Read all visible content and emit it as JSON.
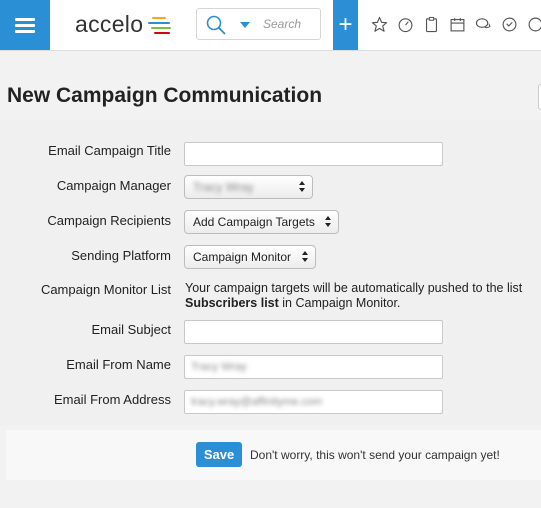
{
  "header": {
    "logo_text": "accelo",
    "search": {
      "placeholder": "Search"
    },
    "add_label": "+",
    "toolbar_icons": [
      "star-icon",
      "dashboard-icon",
      "clipboard-icon",
      "calendar-icon",
      "chat-icon",
      "clock-icon",
      "alert-icon"
    ]
  },
  "page": {
    "title": "New Campaign Communication"
  },
  "form": {
    "email_campaign_title": {
      "label": "Email Campaign Title",
      "value": ""
    },
    "campaign_manager": {
      "label": "Campaign Manager",
      "value": "Tracy Wray"
    },
    "campaign_recipients": {
      "label": "Campaign Recipients",
      "value": "Add Campaign Targets"
    },
    "sending_platform": {
      "label": "Sending Platform",
      "value": "Campaign Monitor"
    },
    "campaign_monitor_list": {
      "label": "Campaign Monitor List",
      "text_1": "Your campaign targets will be automatically pushed to the list",
      "text_bold": "Subscribers list",
      "text_2": " in Campaign Monitor."
    },
    "email_subject": {
      "label": "Email Subject",
      "value": ""
    },
    "email_from_name": {
      "label": "Email From Name",
      "value": "Tracy Wray"
    },
    "email_from_address": {
      "label": "Email From Address",
      "value": "tracy.wray@affinityme.com"
    }
  },
  "footer": {
    "save_label": "Save",
    "note": "Don't worry, this won't send your campaign yet!"
  },
  "colors": {
    "accent": "#2b8fd6",
    "background": "#f0f0f0"
  }
}
